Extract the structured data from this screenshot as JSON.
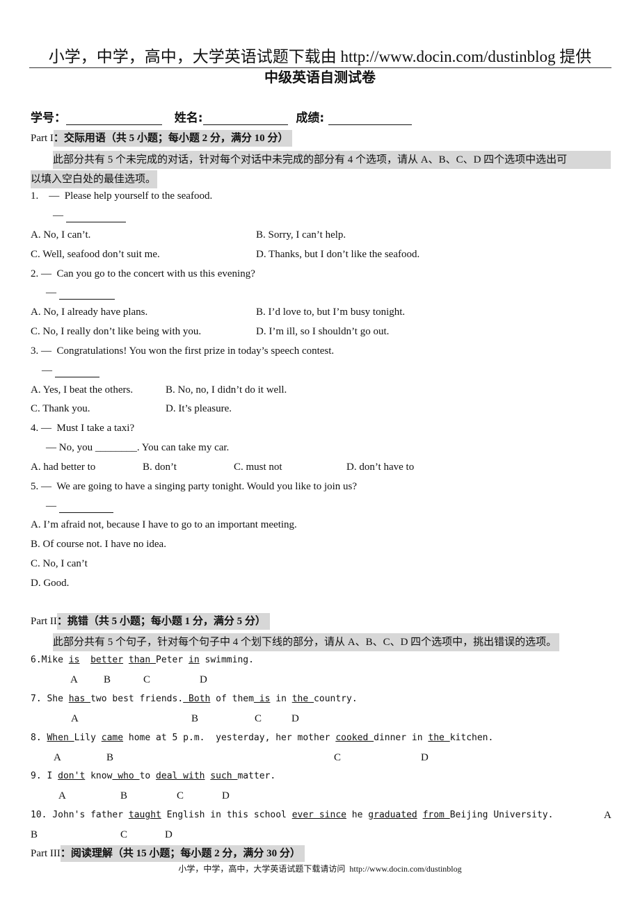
{
  "header": {
    "banner": "小学，中学，高中，大学英语试题下载由 http://www.docin.com/dustinblog 提供",
    "title": "中级英语自测试卷"
  },
  "info": {
    "id_label": "学号：",
    "name_label": "姓名:",
    "score_label": "成绩:"
  },
  "part1": {
    "label": "Part I",
    "heading": "：交际用语（共 5 小题；每小题 2 分，满分 10 分）",
    "instructions_line1": "此部分共有 5 个未完成的对话，针对每个对话中未完成的部分有 4 个选项，请从 A、B、C、D 四个选项中选出可",
    "instructions_line2": "以填入空白处的最佳选项。",
    "questions": [
      {
        "prompt": "1.    —  Please help yourself to the seafood.",
        "reply": "—",
        "a": "A. No, I can’t.",
        "b": "B. Sorry, I can’t help.",
        "c": "C. Well, seafood don’t suit me.",
        "d": "D. Thanks, but I don’t like the seafood."
      },
      {
        "prompt": "2. —  Can you go to the concert with us this evening?",
        "reply": "—",
        "a": "A. No, I already have plans.",
        "b": "B. I’d love to, but I’m busy tonight.",
        "c": "C. No, I really don’t like being with you.",
        "d": "D. I’m ill, so I shouldn’t go out."
      },
      {
        "prompt": "3. —  Congratulations! You won the first prize in today’s speech contest.",
        "reply": "—",
        "a": "A. Yes, I beat the others.",
        "b": "B. No, no, I didn’t do it well.",
        "c": "C. Thank you.",
        "d": "D. It’s pleasure."
      },
      {
        "prompt": "4. —  Must I take a taxi?",
        "reply": "— No, you ________. You can take my car.",
        "a": "A. had better to",
        "b": "B. don’t",
        "c": "C. must not",
        "d": "D. don’t have to"
      },
      {
        "prompt": "5. —  We are going to have a singing party tonight. Would you like to join us?",
        "reply": "—",
        "a": "A. I’m afraid not, because I have to go to an important meeting.",
        "b": "B. Of course not. I have no idea.",
        "c": "C. No, I can’t",
        "d": "D. Good."
      }
    ]
  },
  "part2": {
    "label": "Part II",
    "heading": "：挑错（共 5 小题；每小题 1 分，满分 5 分）",
    "instructions": "此部分共有 5 个句子，针对每个句子中 4 个划下线的部分，请从 A、B、C、D 四个选项中，挑出错误的选项。",
    "sentences": [
      {
        "segments": [
          {
            "t": "6.Mike "
          },
          {
            "t": "is",
            "u": true
          },
          {
            "t": "  "
          },
          {
            "t": "better",
            "u": true
          },
          {
            "t": " "
          },
          {
            "t": "than ",
            "u": true
          },
          {
            "t": "Peter "
          },
          {
            "t": "in",
            "u": true
          },
          {
            "t": " swimming."
          }
        ],
        "letters": [
          "A",
          "B",
          "C",
          "D"
        ]
      },
      {
        "segments": [
          {
            "t": "7. She "
          },
          {
            "t": "has ",
            "u": true
          },
          {
            "t": "two best friends."
          },
          {
            "t": " Both",
            "u": true
          },
          {
            "t": " of them"
          },
          {
            "t": " is",
            "u": true
          },
          {
            "t": " in "
          },
          {
            "t": "the ",
            "u": true
          },
          {
            "t": "country."
          }
        ],
        "letters": [
          "A",
          "B",
          "C",
          "D"
        ]
      },
      {
        "segments": [
          {
            "t": "8. "
          },
          {
            "t": "When ",
            "u": true
          },
          {
            "t": "Lily "
          },
          {
            "t": "came",
            "u": true
          },
          {
            "t": " home at 5 p.m.  yesterday, her mother "
          },
          {
            "t": "cooked ",
            "u": true
          },
          {
            "t": "dinner in "
          },
          {
            "t": "the ",
            "u": true
          },
          {
            "t": "kitchen."
          }
        ],
        "letters": [
          "A",
          "B",
          "C",
          "D"
        ]
      },
      {
        "segments": [
          {
            "t": "9. I "
          },
          {
            "t": "don't",
            "u": true
          },
          {
            "t": " know"
          },
          {
            "t": " who ",
            "u": true
          },
          {
            "t": "to "
          },
          {
            "t": "deal with",
            "u": true
          },
          {
            "t": " "
          },
          {
            "t": "such ",
            "u": true
          },
          {
            "t": "matter."
          }
        ],
        "letters": [
          "A",
          "B",
          "C",
          "D"
        ]
      },
      {
        "segments": [
          {
            "t": "10. John's father "
          },
          {
            "t": "taught",
            "u": true
          },
          {
            "t": " English in this school "
          },
          {
            "t": "ever since",
            "u": true
          },
          {
            "t": " he "
          },
          {
            "t": "graduated",
            "u": true
          },
          {
            "t": " "
          },
          {
            "t": "from ",
            "u": true
          },
          {
            "t": "Beijing University."
          }
        ],
        "letters": [
          "A",
          "B",
          "C",
          "D"
        ]
      }
    ]
  },
  "part3": {
    "label": "Part III",
    "heading": "：阅读理解（共 15 小题；每小题 2 分，满分 30 分）"
  },
  "footer": "小学，中学，高中，大学英语试题下载请访问  http://www.docin.com/dustinblog"
}
